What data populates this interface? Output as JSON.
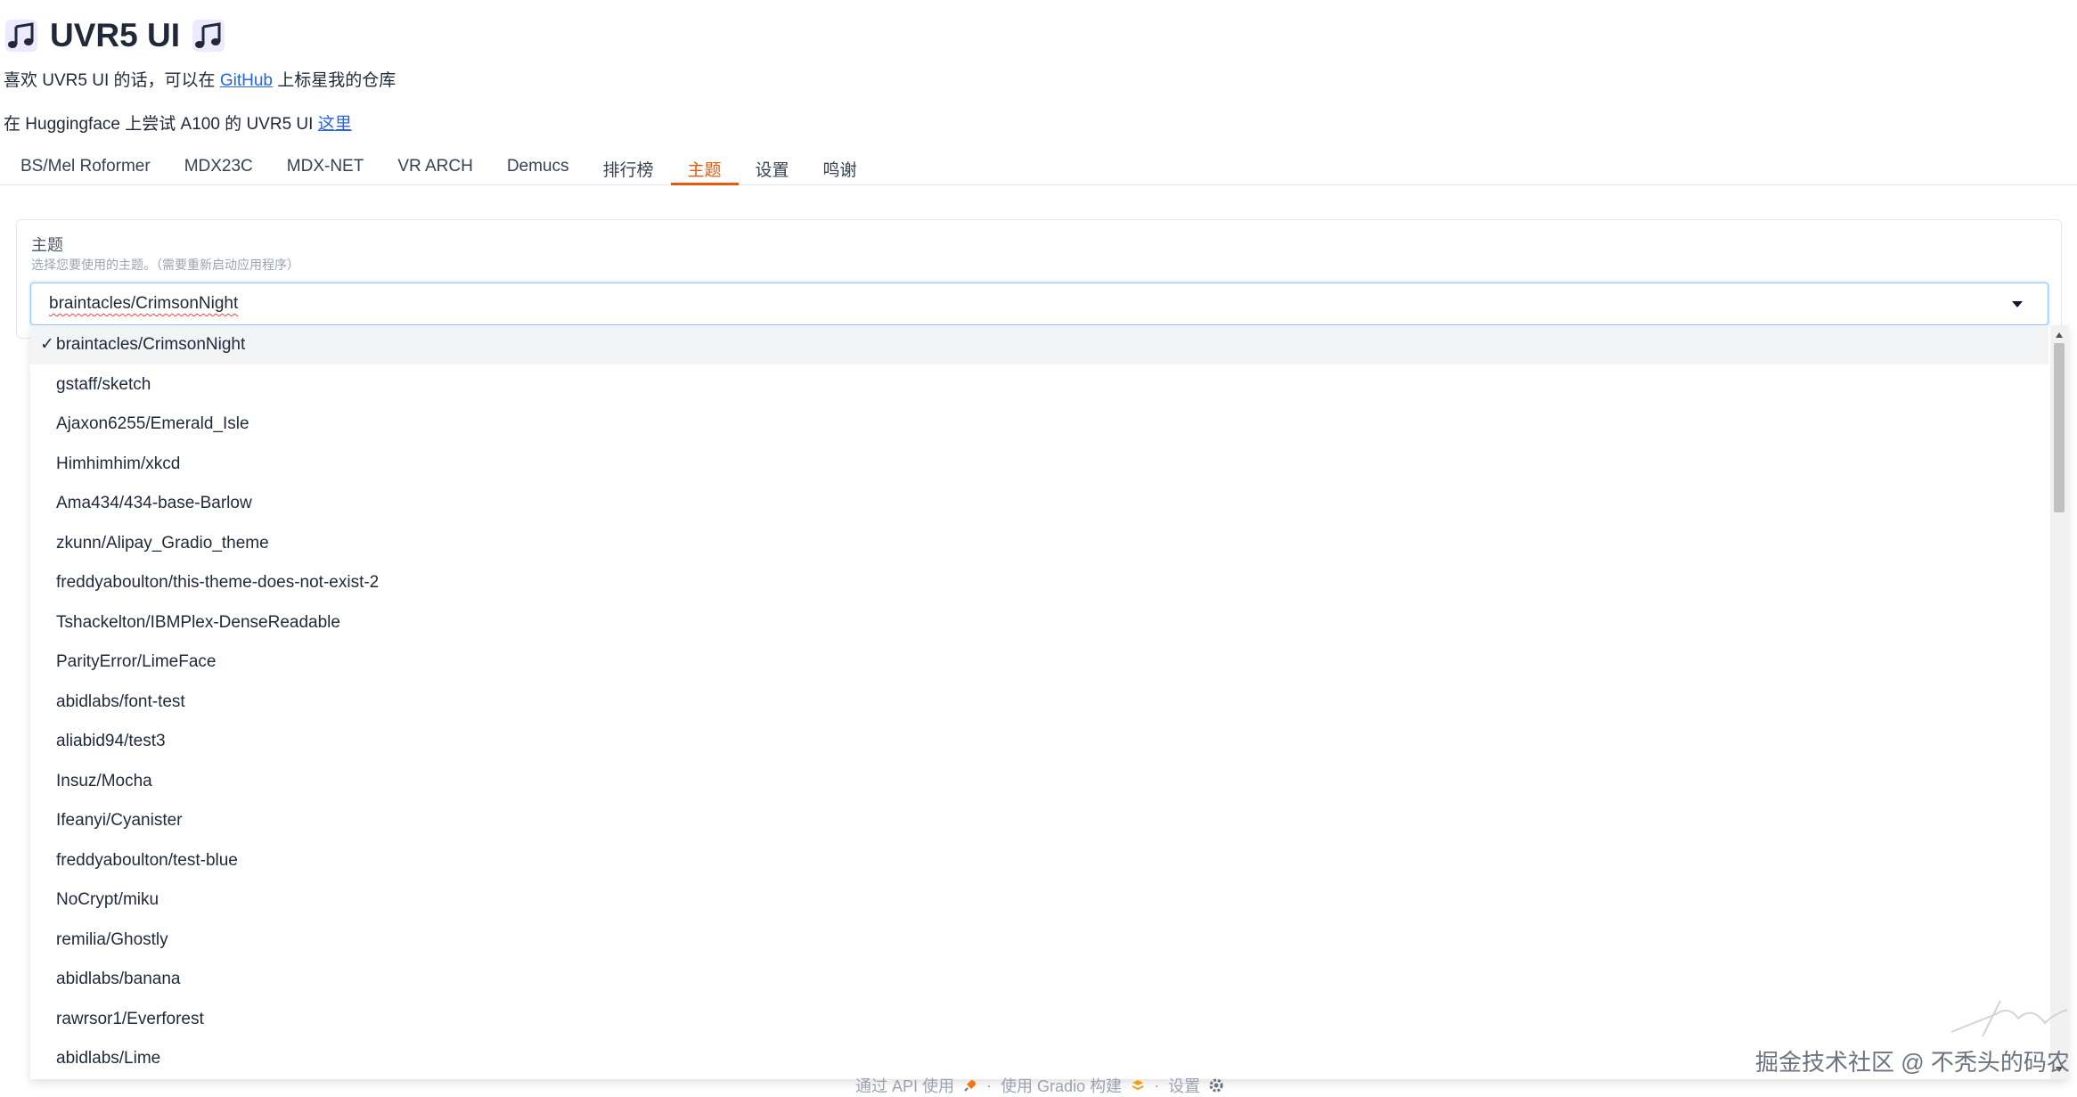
{
  "header": {
    "title": "UVR5 UI",
    "note_icon": "music-note-icon"
  },
  "intro": {
    "line1_prefix": "喜欢 UVR5 UI 的话，可以在 ",
    "line1_link": "GitHub",
    "line1_suffix": " 上标星我的仓库",
    "line2_prefix": "在 Huggingface 上尝试 A100 的 UVR5 UI ",
    "line2_link": "这里"
  },
  "tabs": [
    {
      "label": "BS/Mel Roformer",
      "active": false
    },
    {
      "label": "MDX23C",
      "active": false
    },
    {
      "label": "MDX-NET",
      "active": false
    },
    {
      "label": "VR ARCH",
      "active": false
    },
    {
      "label": "Demucs",
      "active": false
    },
    {
      "label": "排行榜",
      "active": false
    },
    {
      "label": "主题",
      "active": true
    },
    {
      "label": "设置",
      "active": false
    },
    {
      "label": "鸣谢",
      "active": false
    }
  ],
  "theme_panel": {
    "label": "主题",
    "info": "选择您要使用的主题。（需要重新启动应用程序）",
    "selected_value": "braintacles/CrimsonNight",
    "check_mark": "✓",
    "options": [
      "braintacles/CrimsonNight",
      "gstaff/sketch",
      "Ajaxon6255/Emerald_Isle",
      "Himhimhim/xkcd",
      "Ama434/434-base-Barlow",
      "zkunn/Alipay_Gradio_theme",
      "freddyaboulton/this-theme-does-not-exist-2",
      "Tshackelton/IBMPlex-DenseReadable",
      "ParityError/LimeFace",
      "abidlabs/font-test",
      "aliabid94/test3",
      "Insuz/Mocha",
      "Ifeanyi/Cyanister",
      "freddyaboulton/test-blue",
      "NoCrypt/miku",
      "remilia/Ghostly",
      "abidlabs/banana",
      "rawrsor1/Everforest",
      "abidlabs/Lime"
    ]
  },
  "footer": {
    "api": "通过 API 使用",
    "api_icon": "rocket-icon",
    "gradio": "使用 Gradio 构建",
    "gradio_icon": "gradio-logo-icon",
    "settings": "设置",
    "settings_icon": "gear-icon",
    "separator": "·"
  },
  "watermark": {
    "text": "掘金技术社区 @ 不秃头的码农"
  },
  "colors": {
    "accent": "#ea580c",
    "link": "#2563eb",
    "focus_border": "#93c5fd"
  }
}
